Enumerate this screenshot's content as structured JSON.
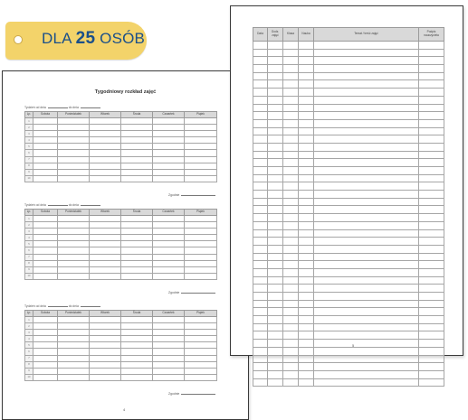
{
  "tag": {
    "prefix": "DLA",
    "count": "25",
    "suffix": "OSÓB"
  },
  "back_page": {
    "title": "Tygodniowy rozkład zajęć",
    "week_from_label": "Tydzień od dnia",
    "week_to_label": "do dnia",
    "columns": [
      "Lp.",
      "Sobota",
      "Poniedziałek",
      "Wtorek",
      "Środa",
      "Czwartek",
      "Piątek"
    ],
    "hours": [
      "1",
      "2",
      "3",
      "4",
      "5",
      "6",
      "7",
      "8",
      "9",
      "10"
    ],
    "signature_label": "Zgodnie",
    "page_number": "4"
  },
  "front_page": {
    "columns": [
      "Data",
      "Godz. zajęć",
      "Klasa",
      "Nauka",
      "Temat / treść zajęć",
      "Podpis nauczyciela"
    ],
    "row_count": 44,
    "page_number": "5"
  }
}
